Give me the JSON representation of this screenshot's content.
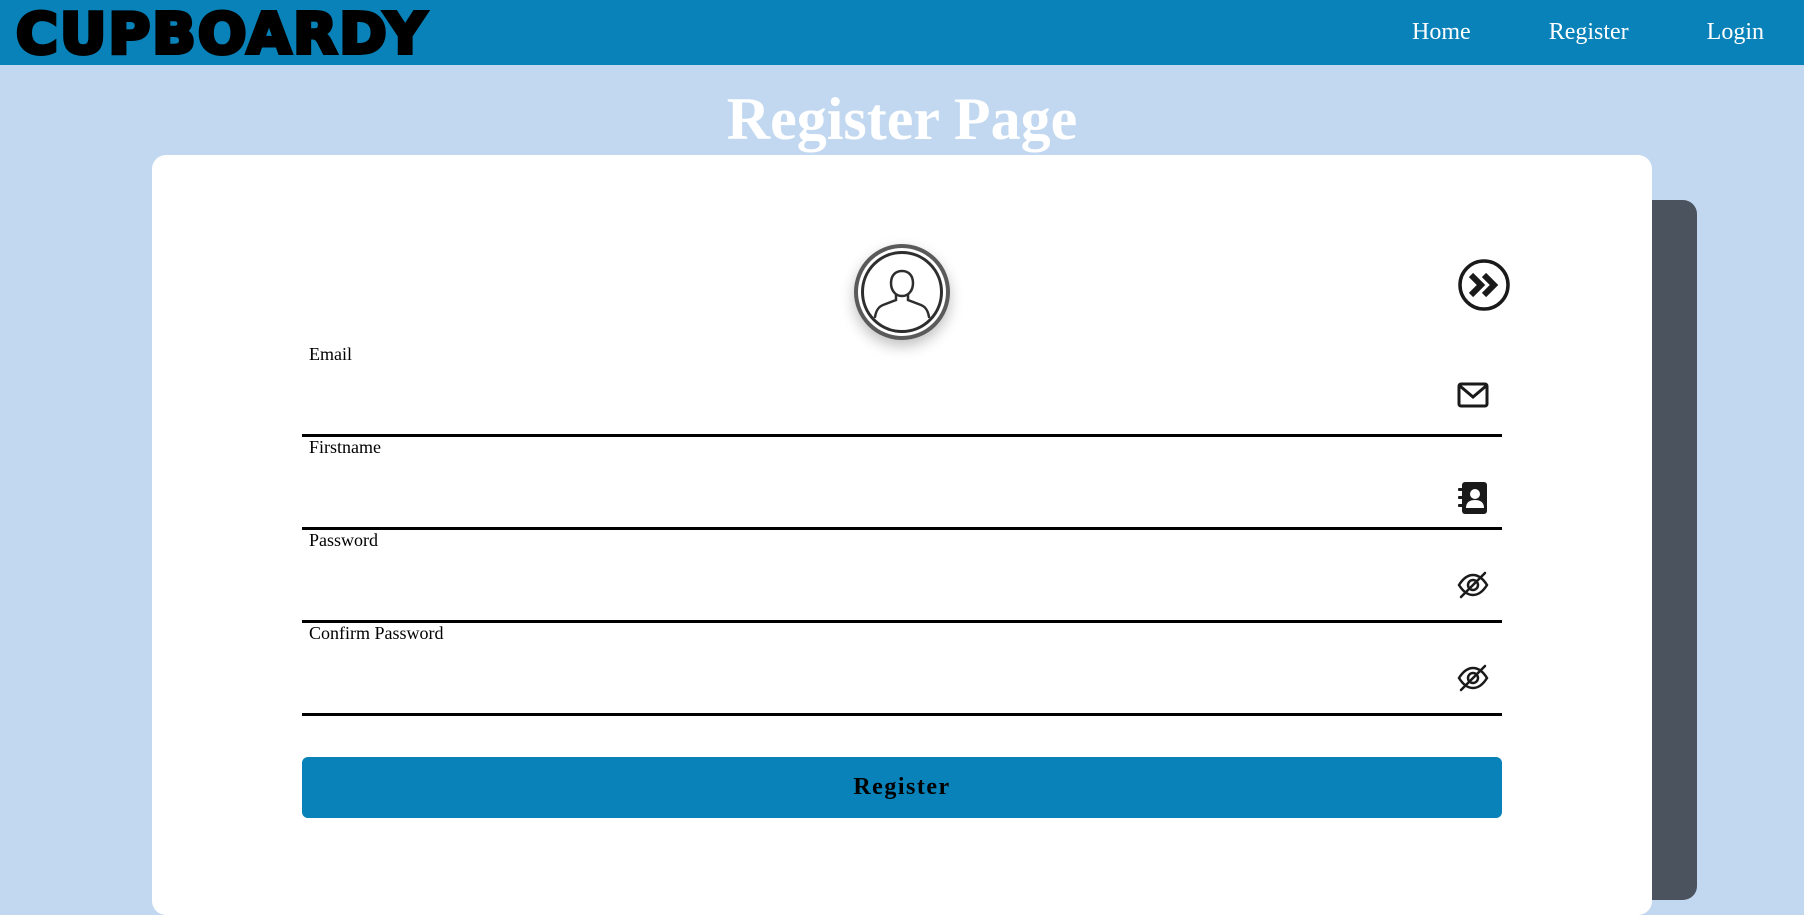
{
  "app": {
    "logo_text": "CUPBOARDY"
  },
  "nav": {
    "home": "Home",
    "register": "Register",
    "login": "Login"
  },
  "page": {
    "title": "Register Page"
  },
  "form": {
    "email_label": "Email",
    "email_value": "",
    "firstname_label": "Firstname",
    "firstname_value": "",
    "password_label": "Password",
    "password_value": "",
    "confirm_label": "Confirm Password",
    "confirm_value": "",
    "submit_label": "Register"
  },
  "icons": {
    "avatar": "user-avatar-icon",
    "switch": "double-chevron-right-icon",
    "email": "envelope-icon",
    "firstname": "contact-book-icon",
    "password": "eye-slash-icon",
    "confirm": "eye-slash-icon"
  },
  "colors": {
    "navbar": "#0882b8",
    "background": "#c2d8f0",
    "card": "#ffffff",
    "side_panel": "#4b535e",
    "button": "#0882b8"
  }
}
